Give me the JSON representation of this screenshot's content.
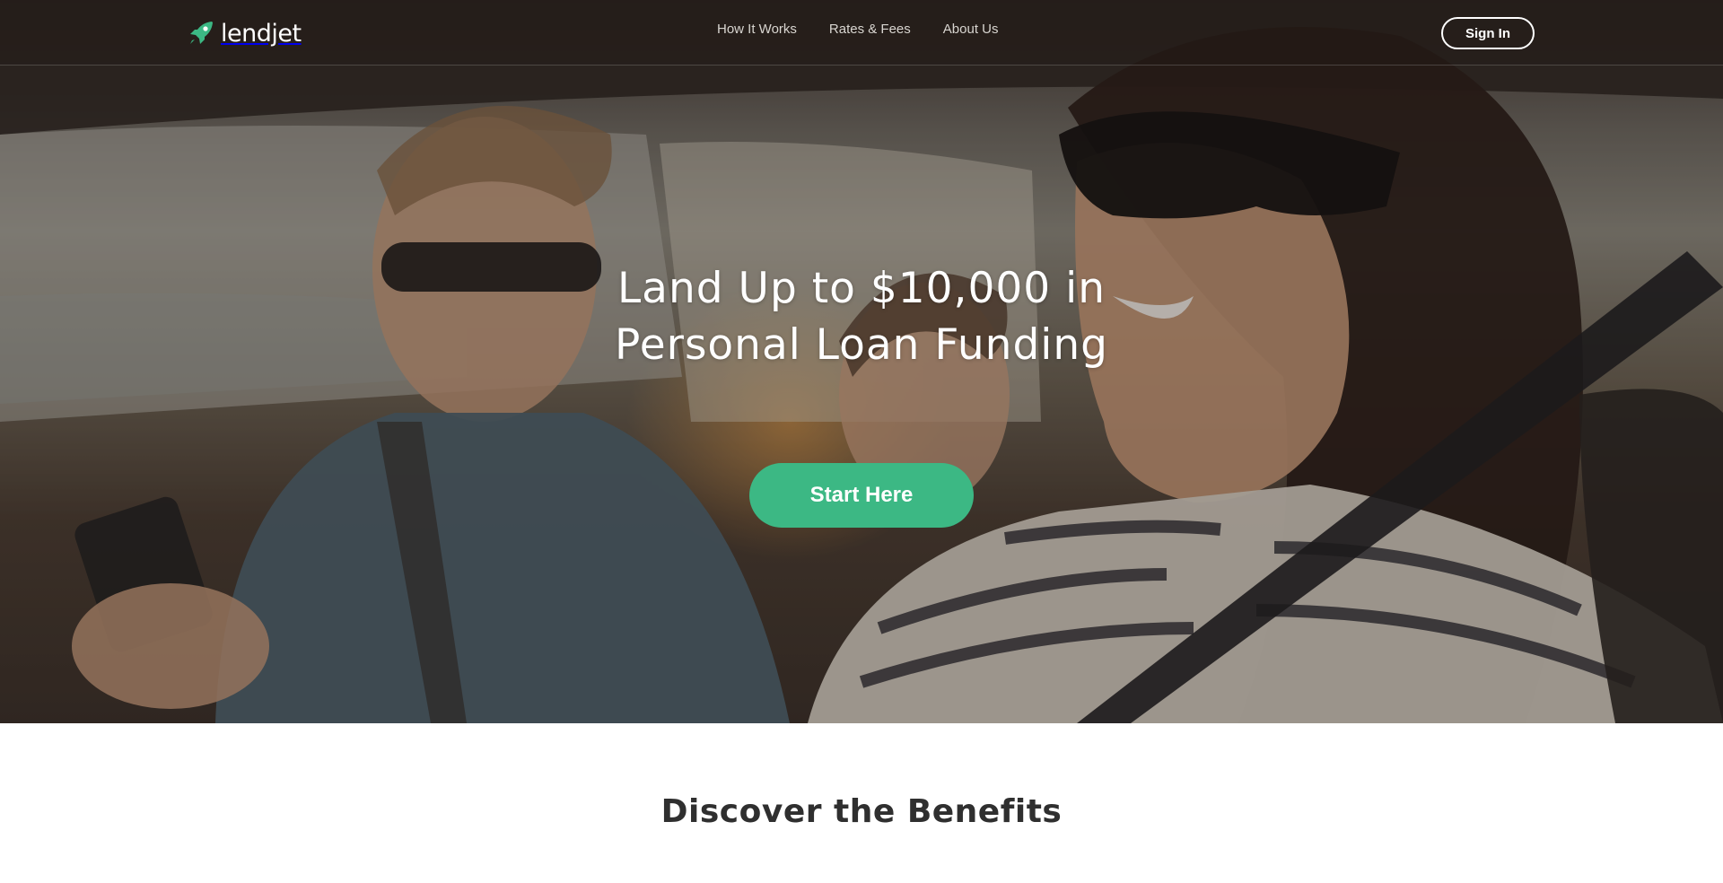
{
  "brand": {
    "name": "lendjet",
    "logo_icon": "rocket-icon",
    "accent": "#3cb884"
  },
  "nav": {
    "items": [
      {
        "label": "How It Works"
      },
      {
        "label": "Rates & Fees"
      },
      {
        "label": "About Us"
      }
    ],
    "sign_in_label": "Sign In"
  },
  "hero": {
    "headline_line1": "Land Up to $10,000 in",
    "headline_line2": "Personal Loan Funding",
    "cta_label": "Start Here",
    "image": "family-in-car-photo"
  },
  "benefits": {
    "title": "Discover the Benefits"
  }
}
